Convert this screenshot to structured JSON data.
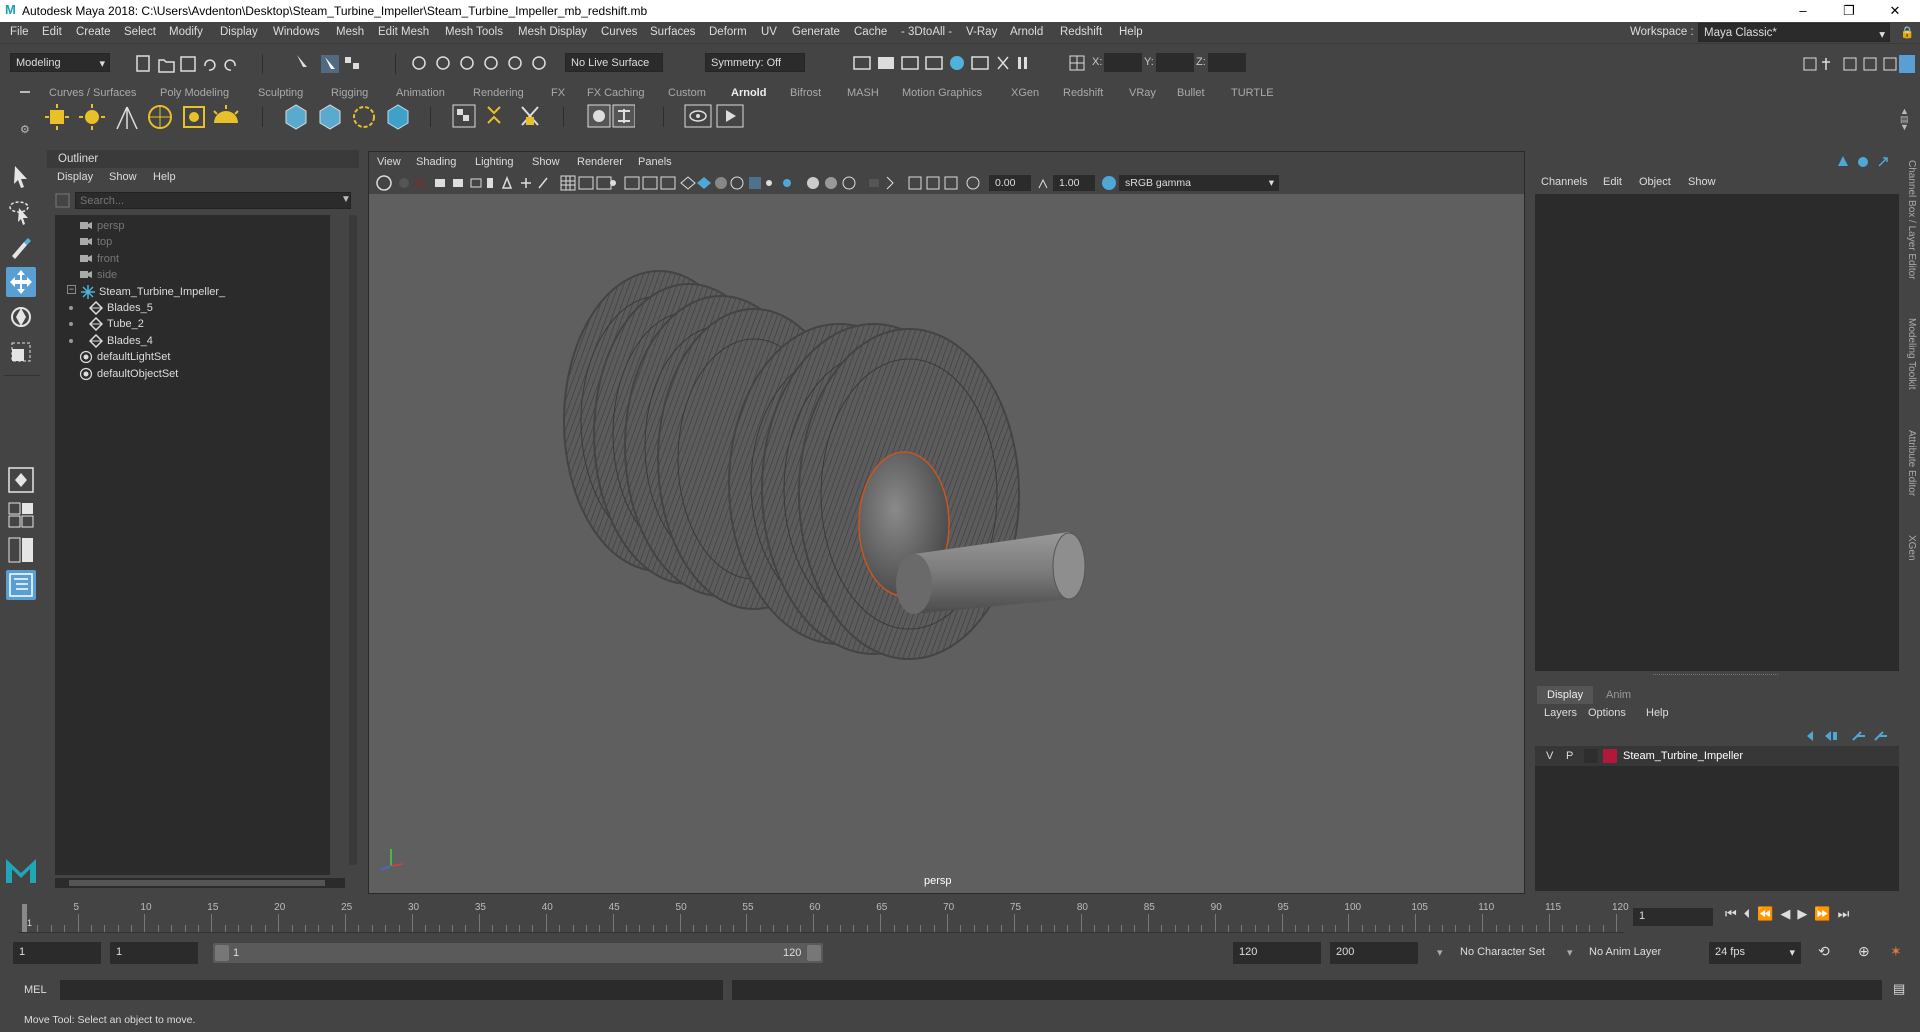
{
  "window": {
    "title": "Autodesk Maya 2018: C:\\Users\\Avdenton\\Desktop\\Steam_Turbine_Impeller\\Steam_Turbine_Impeller_mb_redshift.mb",
    "controls": [
      "–",
      "❐",
      "✕"
    ]
  },
  "menubar": {
    "items": [
      "File",
      "Edit",
      "Create",
      "Select",
      "Modify",
      "Display",
      "Windows",
      "Mesh",
      "Edit Mesh",
      "Mesh Tools",
      "Mesh Display",
      "Curves",
      "Surfaces",
      "Deform",
      "UV",
      "Generate",
      "Cache",
      "- 3DtoAll -",
      "V-Ray",
      "Arnold",
      "Redshift",
      "Help"
    ],
    "workspace_label": "Workspace :",
    "workspace_value": "Maya Classic*"
  },
  "statusline": {
    "mode": "Modeling",
    "live_surface": "No Live Surface",
    "symmetry": "Symmetry: Off",
    "x_label": "X:",
    "y_label": "Y:",
    "z_label": "Z:"
  },
  "shelf": {
    "tabs": [
      "Curves / Surfaces",
      "Poly Modeling",
      "Sculpting",
      "Rigging",
      "Animation",
      "Rendering",
      "FX",
      "FX Caching",
      "Custom",
      "Arnold",
      "Bifrost",
      "MASH",
      "Motion Graphics",
      "XGen",
      "Redshift",
      "VRay",
      "Bullet",
      "TURTLE"
    ],
    "active_tab": "Arnold"
  },
  "outliner": {
    "title": "Outliner",
    "menu": [
      "Display",
      "Show",
      "Help"
    ],
    "search_placeholder": "Search...",
    "items": [
      {
        "label": "persp",
        "dim": true,
        "indent": 0,
        "icon": "camera-icon"
      },
      {
        "label": "top",
        "dim": true,
        "indent": 0,
        "icon": "camera-icon"
      },
      {
        "label": "front",
        "dim": true,
        "indent": 0,
        "icon": "camera-icon"
      },
      {
        "label": "side",
        "dim": true,
        "indent": 0,
        "icon": "camera-icon"
      },
      {
        "label": "Steam_Turbine_Impeller_",
        "dim": false,
        "indent": 0,
        "icon": "group-icon",
        "expander": "−"
      },
      {
        "label": "Blades_5",
        "dim": false,
        "indent": 1,
        "icon": "mesh-icon"
      },
      {
        "label": "Tube_2",
        "dim": false,
        "indent": 1,
        "icon": "mesh-icon"
      },
      {
        "label": "Blades_4",
        "dim": false,
        "indent": 1,
        "icon": "mesh-icon"
      },
      {
        "label": "defaultLightSet",
        "dim": false,
        "indent": 0,
        "icon": "set-icon"
      },
      {
        "label": "defaultObjectSet",
        "dim": false,
        "indent": 0,
        "icon": "set-icon"
      }
    ]
  },
  "viewport": {
    "menu": [
      "View",
      "Shading",
      "Lighting",
      "Show",
      "Renderer",
      "Panels"
    ],
    "exposure": "0.00",
    "gamma": "1.00",
    "color_space": "sRGB gamma",
    "camera_label": "persp"
  },
  "channelbox": {
    "menu": [
      "Channels",
      "Edit",
      "Object",
      "Show"
    ]
  },
  "layereditor": {
    "tabs": [
      "Display",
      "Anim"
    ],
    "menu": [
      "Layers",
      "Options",
      "Help"
    ],
    "layer": {
      "v": "V",
      "p": "P",
      "name": "Steam_Turbine_Impeller",
      "color": "#b0193a"
    }
  },
  "sidetabs": [
    "Channel Box / Layer Editor",
    "Modeling Toolkit",
    "Attribute Editor",
    "XGen"
  ],
  "timeline": {
    "ticks": [
      5,
      10,
      15,
      20,
      25,
      30,
      35,
      40,
      45,
      50,
      55,
      60,
      65,
      70,
      75,
      80,
      85,
      90,
      95,
      100,
      105,
      110,
      115,
      120
    ],
    "start_tick": "1",
    "current_frame": "1"
  },
  "range": {
    "start": "1",
    "playback_start": "1",
    "slider_start": "1",
    "slider_end": "120",
    "playback_end": "120",
    "end": "200",
    "character_set": "No Character Set",
    "anim_layer": "No Anim Layer",
    "fps": "24 fps"
  },
  "cmdline": {
    "label": "MEL"
  },
  "helpline": {
    "text": "Move Tool: Select an object to move."
  },
  "colors": {
    "accent": "#5a9fd4",
    "orange_edge": "#c8561e",
    "layer_color": "#b0193a"
  }
}
